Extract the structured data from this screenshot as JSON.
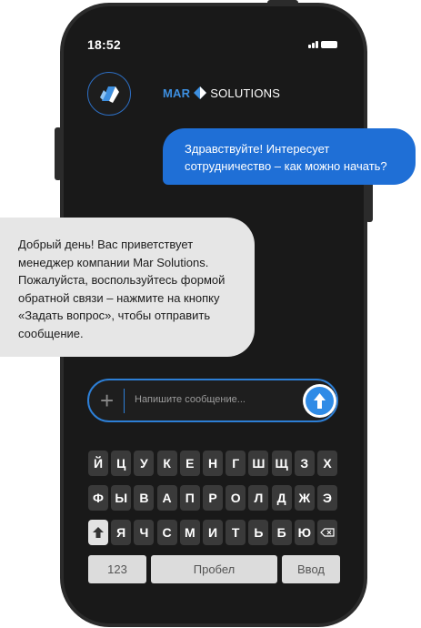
{
  "status_bar": {
    "time": "18:52"
  },
  "header": {
    "brand_prefix": "MAR",
    "brand_suffix": "SOLUTIONS",
    "avatar_icon": "mar-solutions-logo-icon",
    "accent_color": "#1f6fd6"
  },
  "messages": {
    "outgoing": "Здравствуйте! Интересует сотрудничество – как можно начать?",
    "incoming": "Добрый день! Вас приветствует менеджер компании Mar Solutions. Пожалуйста, воспользуйтесь формой обратной связи – нажмите на кнопку «Задать вопрос», чтобы отправить сообщение."
  },
  "composer": {
    "placeholder": "Напишите сообщение...",
    "attach_icon": "plus-icon",
    "send_icon": "arrow-up-icon"
  },
  "keyboard": {
    "row1": [
      "Й",
      "Ц",
      "У",
      "К",
      "Е",
      "Н",
      "Г",
      "Ш",
      "Щ",
      "З",
      "Х"
    ],
    "row2": [
      "Ф",
      "Ы",
      "В",
      "А",
      "П",
      "Р",
      "О",
      "Л",
      "Д",
      "Ж",
      "Э"
    ],
    "row3": [
      "Я",
      "Ч",
      "С",
      "М",
      "И",
      "Т",
      "Ь",
      "Б",
      "Ю"
    ],
    "shift_icon": "shift-arrow-icon",
    "backspace_icon": "backspace-icon",
    "numbers_label": "123",
    "space_label": "Пробел",
    "enter_label": "Ввод"
  }
}
